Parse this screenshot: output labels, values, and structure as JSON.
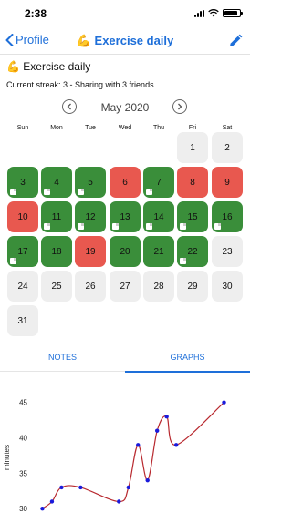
{
  "status_bar": {
    "time": "2:38"
  },
  "nav": {
    "back_label": "Profile",
    "title": "💪 Exercise daily"
  },
  "habit": {
    "title": "💪 Exercise daily",
    "subtitle": "Current streak: 3 - Sharing with 3 friends"
  },
  "calendar": {
    "month_label": "May 2020",
    "weekdays": [
      "Sun",
      "Mon",
      "Tue",
      "Wed",
      "Thu",
      "Fri",
      "Sat"
    ],
    "days": [
      {
        "day": "1",
        "status": "empty",
        "note": false
      },
      {
        "day": "2",
        "status": "empty",
        "note": false
      },
      {
        "day": "3",
        "status": "green",
        "note": true
      },
      {
        "day": "4",
        "status": "green",
        "note": true
      },
      {
        "day": "5",
        "status": "green",
        "note": true
      },
      {
        "day": "6",
        "status": "red",
        "note": false
      },
      {
        "day": "7",
        "status": "green",
        "note": true
      },
      {
        "day": "8",
        "status": "red",
        "note": false
      },
      {
        "day": "9",
        "status": "red",
        "note": false
      },
      {
        "day": "10",
        "status": "red",
        "note": false
      },
      {
        "day": "11",
        "status": "green",
        "note": true
      },
      {
        "day": "12",
        "status": "green",
        "note": true
      },
      {
        "day": "13",
        "status": "green",
        "note": true
      },
      {
        "day": "14",
        "status": "green",
        "note": true
      },
      {
        "day": "15",
        "status": "green",
        "note": true
      },
      {
        "day": "16",
        "status": "green",
        "note": true
      },
      {
        "day": "17",
        "status": "green",
        "note": true
      },
      {
        "day": "18",
        "status": "green",
        "note": false
      },
      {
        "day": "19",
        "status": "red",
        "note": false
      },
      {
        "day": "20",
        "status": "green",
        "note": false
      },
      {
        "day": "21",
        "status": "green",
        "note": false
      },
      {
        "day": "22",
        "status": "green",
        "note": true
      },
      {
        "day": "23",
        "status": "empty",
        "note": false
      },
      {
        "day": "24",
        "status": "empty",
        "note": false
      },
      {
        "day": "25",
        "status": "empty",
        "note": false
      },
      {
        "day": "26",
        "status": "empty",
        "note": false
      },
      {
        "day": "27",
        "status": "empty",
        "note": false
      },
      {
        "day": "28",
        "status": "empty",
        "note": false
      },
      {
        "day": "29",
        "status": "empty",
        "note": false
      },
      {
        "day": "30",
        "status": "empty",
        "note": false
      },
      {
        "day": "31",
        "status": "empty",
        "note": false
      }
    ]
  },
  "tabs": {
    "notes_label": "NOTES",
    "graphs_label": "GRAPHS",
    "active": "graphs"
  },
  "colors": {
    "accent": "#1e6fd9",
    "success": "#3a8e3a",
    "fail": "#e8584f",
    "empty": "#eeeeee",
    "line": "#b8292f",
    "point": "#1a1adb"
  },
  "chart_data": {
    "type": "line",
    "title": "",
    "xlabel": "",
    "ylabel": "minutes",
    "y_ticks": [
      30,
      35,
      40,
      45
    ],
    "ylim": [
      29,
      46.5
    ],
    "x": [
      3,
      4,
      5,
      7,
      11,
      12,
      13,
      14,
      15,
      16,
      17,
      22
    ],
    "values": [
      30,
      31,
      33,
      33,
      31,
      33,
      39,
      34,
      41,
      43,
      39,
      45
    ],
    "xlim": [
      2,
      23
    ],
    "smoothed": true
  }
}
